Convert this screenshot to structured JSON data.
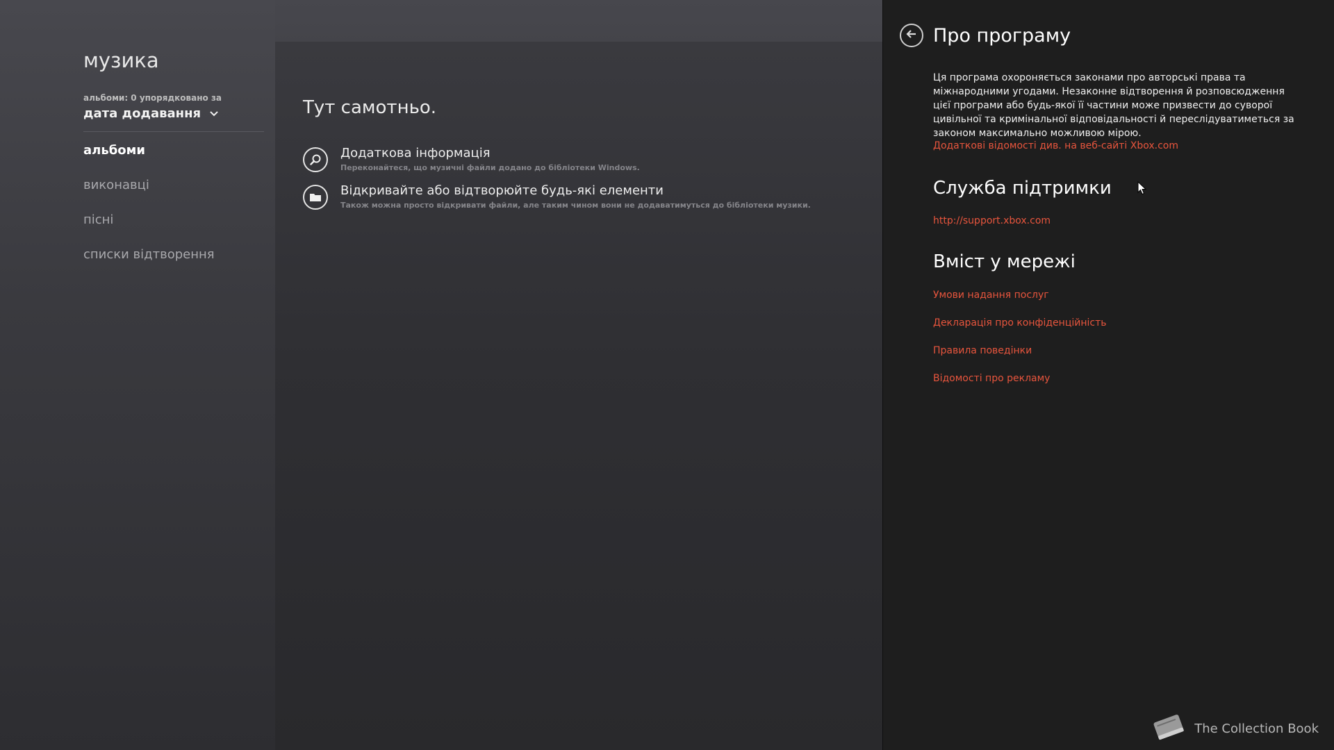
{
  "app": {
    "title": "музика"
  },
  "sort": {
    "caption": "альбоми: 0 упорядковано за",
    "selected": "дата додавання"
  },
  "nav": {
    "items": [
      {
        "label": "альбоми",
        "active": true
      },
      {
        "label": "виконавці",
        "active": false
      },
      {
        "label": "пісні",
        "active": false
      },
      {
        "label": "списки відтворення",
        "active": false
      }
    ]
  },
  "main": {
    "heading": "Тут самотньо.",
    "actions": [
      {
        "icon": "search-icon",
        "title": "Додаткова інформація",
        "description": "Переконайтеся, що музичні файли додано до бібліотеки Windows."
      },
      {
        "icon": "folder-icon",
        "title": "Відкривайте або відтворюйте будь-які елементи",
        "description": "Також можна просто відкривати файли, але таким чином вони не додаватимуться до бібліотеки музики."
      }
    ]
  },
  "about": {
    "title": "Про програму",
    "legal_text": "Ця програма охороняється законами про авторські права та міжнародними угодами. Незаконне відтворення й розповсюдження цієї програми або будь-якої її частини може призвести до суворої цивільної та кримінальної відповідальності й переслідуватиметься за законом максимально можливою мірою.",
    "details_link": "Додаткові відомості див. на веб-сайті Xbox.com",
    "support_heading": "Служба підтримки",
    "support_link": "http://support.xbox.com",
    "online_heading": "Вміст у мережі",
    "online_links": [
      "Умови надання послуг",
      "Декларація про конфіденційність",
      "Правила поведінки",
      "Відомості про рекламу"
    ]
  },
  "watermark": {
    "text": "The Collection Book",
    "icon": "book-icon"
  },
  "colors": {
    "link": "#e8553d",
    "panel_bg": "#1e1e1e"
  }
}
